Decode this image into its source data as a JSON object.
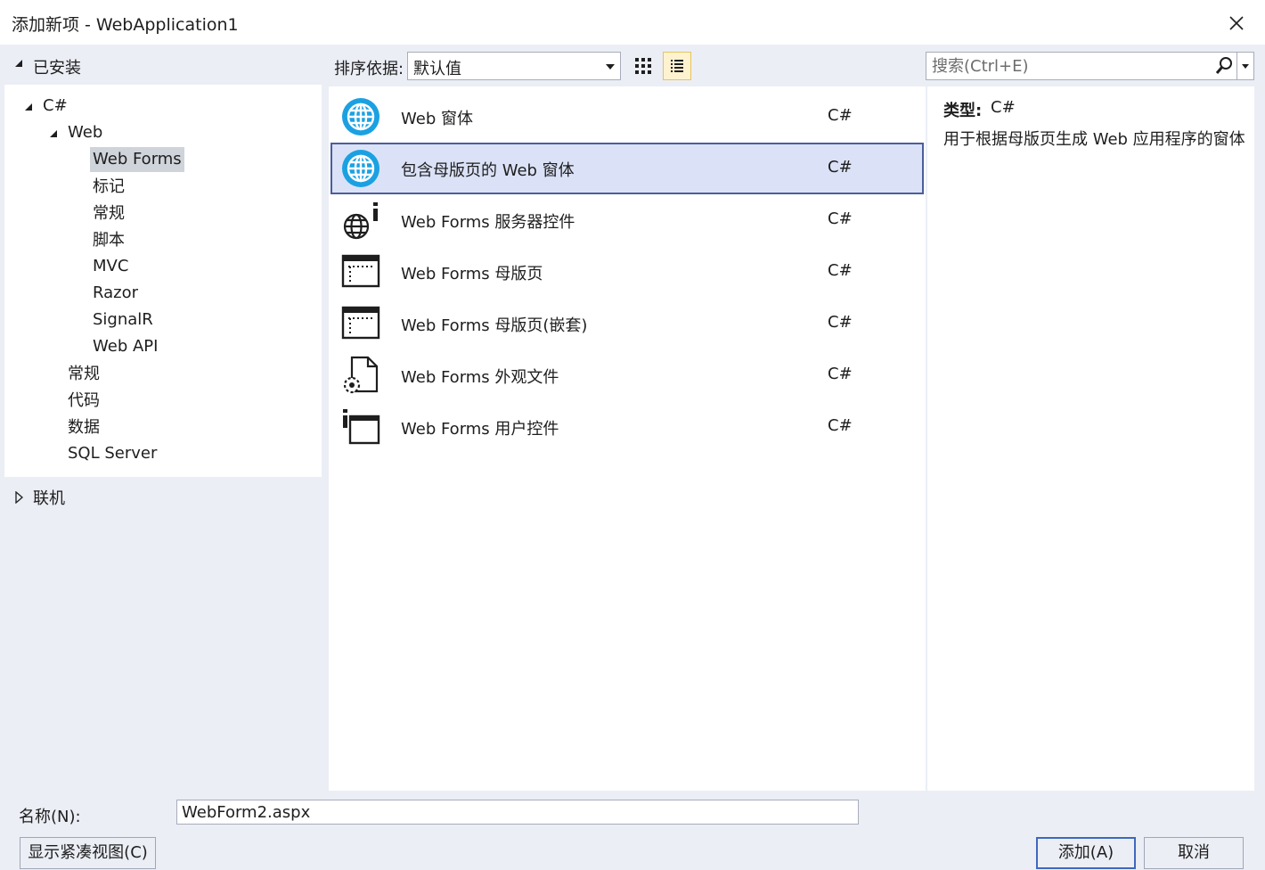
{
  "window": {
    "title": "添加新项 - WebApplication1"
  },
  "left": {
    "installed": "已安装",
    "tree": [
      {
        "label": "C#"
      },
      {
        "label": "Web"
      },
      {
        "label": "Web Forms"
      },
      {
        "label": "标记"
      },
      {
        "label": "常规"
      },
      {
        "label": "脚本"
      },
      {
        "label": "MVC"
      },
      {
        "label": "Razor"
      },
      {
        "label": "SignalR"
      },
      {
        "label": "Web API"
      },
      {
        "label": "常规"
      },
      {
        "label": "代码"
      },
      {
        "label": "数据"
      },
      {
        "label": "SQL Server"
      }
    ],
    "online": "联机"
  },
  "toolbar": {
    "sort_label": "排序依据:",
    "sort_value": "默认值",
    "search_placeholder": "搜索(Ctrl+E)"
  },
  "templates": [
    {
      "name": "Web 窗体",
      "lang": "C#",
      "icon": "globe-icon"
    },
    {
      "name": "包含母版页的 Web 窗体",
      "lang": "C#",
      "icon": "globe-icon"
    },
    {
      "name": "Web Forms 服务器控件",
      "lang": "C#",
      "icon": "server-control-icon"
    },
    {
      "name": "Web Forms 母版页",
      "lang": "C#",
      "icon": "master-page-icon"
    },
    {
      "name": "Web Forms 母版页(嵌套)",
      "lang": "C#",
      "icon": "master-page-icon"
    },
    {
      "name": "Web Forms 外观文件",
      "lang": "C#",
      "icon": "skin-file-icon"
    },
    {
      "name": "Web Forms 用户控件",
      "lang": "C#",
      "icon": "user-control-icon"
    }
  ],
  "detail": {
    "type_key": "类型:",
    "type_value": "C#",
    "description": "用于根据母版页生成 Web 应用程序的窗体"
  },
  "bottom": {
    "name_label": "名称(N):",
    "name_value": "WebForm2.aspx",
    "compact_view": "显示紧凑视图(C)",
    "add": "添加(A)",
    "cancel": "取消"
  },
  "colors": {
    "accent": "#4b5e9c",
    "selection": "#dbe2f7",
    "globe": "#1ba1e2"
  }
}
